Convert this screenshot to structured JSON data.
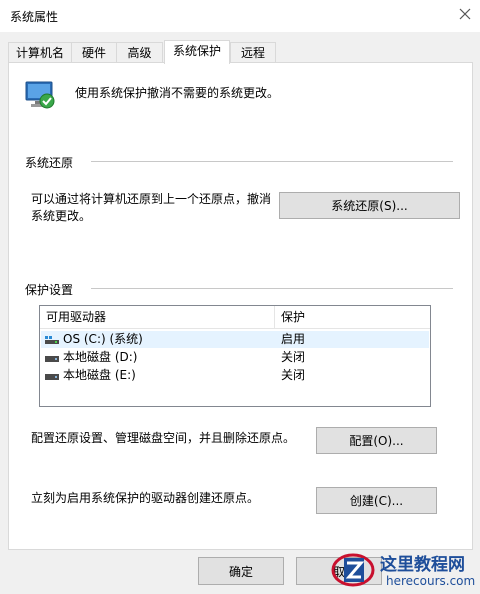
{
  "window": {
    "title": "系统属性"
  },
  "tabs": [
    {
      "label": "计算机名"
    },
    {
      "label": "硬件"
    },
    {
      "label": "高级"
    },
    {
      "label": "系统保护"
    },
    {
      "label": "远程"
    }
  ],
  "intro": {
    "text": "使用系统保护撤消不需要的系统更改。"
  },
  "restore": {
    "group_title": "系统还原",
    "description_line1": "可以通过将计算机还原到上一个还原点，撤消",
    "description_line2": "系统更改。",
    "button_label": "系统还原(S)..."
  },
  "protection": {
    "group_title": "保护设置",
    "columns": [
      "可用驱动器",
      "保护"
    ],
    "drives": [
      {
        "name": "OS (C:) (系统)",
        "status": "启用",
        "selected": true,
        "icon": "system-drive-icon"
      },
      {
        "name": "本地磁盘 (D:)",
        "status": "关闭",
        "selected": false,
        "icon": "disk-drive-icon"
      },
      {
        "name": "本地磁盘 (E:)",
        "status": "关闭",
        "selected": false,
        "icon": "disk-drive-icon"
      }
    ],
    "configure_text": "配置还原设置、管理磁盘空间，并且删除还原点。",
    "configure_button": "配置(O)...",
    "create_text": "立刻为启用系统保护的驱动器创建还原点。",
    "create_button": "创建(C)..."
  },
  "footer": {
    "ok_label": "确定",
    "cancel_label": "取"
  },
  "watermark": {
    "brand": "这里教程网",
    "url": "herecours.com",
    "accent": "#c8102e"
  }
}
